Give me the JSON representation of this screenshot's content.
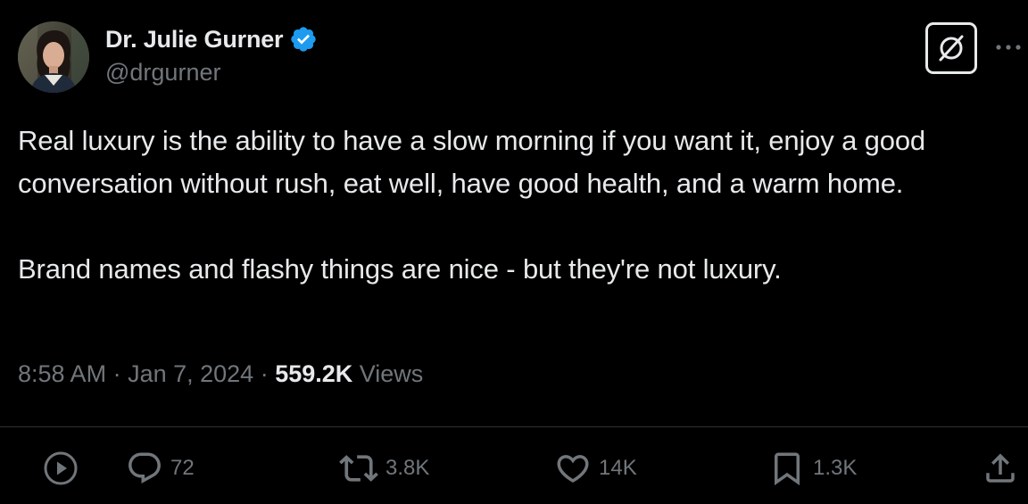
{
  "author": {
    "display_name": "Dr. Julie Gurner",
    "handle": "@drgurner",
    "verified": true
  },
  "tweet": {
    "paragraphs": [
      "Real luxury is the ability to have a slow morning if you want it, enjoy a good conversation without rush, eat well, have good health, and a warm home.",
      "Brand names and flashy things are nice - but they're not luxury."
    ]
  },
  "meta": {
    "time": "8:58 AM",
    "separator_1": " · ",
    "date": "Jan 7, 2024",
    "separator_2": " · ",
    "views_count": "559.2K",
    "views_label": " Views"
  },
  "actions": {
    "replies": "72",
    "reposts": "3.8K",
    "likes": "14K",
    "bookmarks": "1.3K"
  },
  "icons": {
    "verified": "verified-badge-icon",
    "grok": "grok-icon",
    "more": "more-dots-icon",
    "play": "play-icon",
    "reply": "reply-icon",
    "repost": "repost-icon",
    "like": "like-icon",
    "bookmark": "bookmark-icon",
    "share": "share-icon"
  },
  "colors": {
    "background": "#000000",
    "primary_text": "#e7e9ea",
    "secondary_text": "#71767b",
    "verified_blue": "#1d9bf0",
    "divider": "#2f3336"
  }
}
